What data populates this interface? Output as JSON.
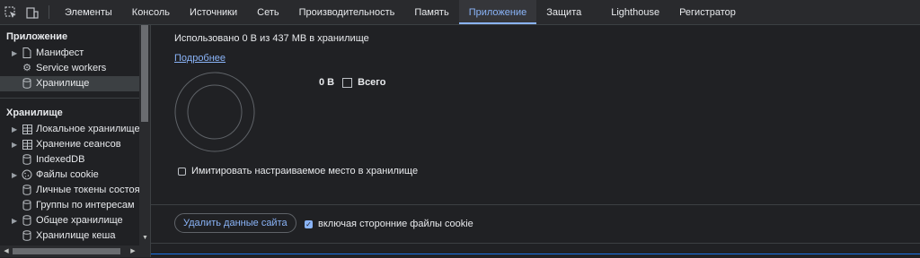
{
  "toolbar": {
    "icons": [
      "inspect-element-icon",
      "device-toolbar-icon"
    ],
    "tabs": [
      {
        "label": "Элементы"
      },
      {
        "label": "Консоль"
      },
      {
        "label": "Источники"
      },
      {
        "label": "Сеть"
      },
      {
        "label": "Производительность"
      },
      {
        "label": "Память"
      },
      {
        "label": "Приложение"
      },
      {
        "label": "Защита"
      },
      {
        "label": "Lighthouse"
      },
      {
        "label": "Регистратор"
      }
    ],
    "active_tab": "Приложение"
  },
  "sidebar": {
    "app_section": {
      "title": "Приложение",
      "items": [
        {
          "label": "Манифест",
          "icon": "file-icon"
        },
        {
          "label": "Service workers",
          "icon": "gears-icon"
        },
        {
          "label": "Хранилище",
          "icon": "database-icon"
        }
      ]
    },
    "storage_section": {
      "title": "Хранилище",
      "items": [
        {
          "label": "Локальное хранилище",
          "icon": "table-icon"
        },
        {
          "label": "Хранение сеансов",
          "icon": "table-icon"
        },
        {
          "label": "IndexedDB",
          "icon": "database-icon"
        },
        {
          "label": "Файлы cookie",
          "icon": "cookie-icon"
        },
        {
          "label": "Личные токены состояния",
          "icon": "database-icon"
        },
        {
          "label": "Группы по интересам",
          "icon": "database-icon"
        },
        {
          "label": "Общее хранилище",
          "icon": "database-icon"
        },
        {
          "label": "Хранилище кеша",
          "icon": "database-icon"
        }
      ]
    }
  },
  "main": {
    "usage_text": "Использовано 0 В из 437 MB в хранилище",
    "more_link": "Подробнее",
    "total_value": "0 В",
    "total_label": "Всего",
    "simulate_quota_label": "Имитировать настраиваемое место в хранилище",
    "simulate_quota_checked": false,
    "clear_button": "Удалить данные сайта",
    "third_party_cookies_label": "включая сторонние файлы cookie",
    "third_party_cookies_checked": true
  },
  "colors": {
    "accent": "#8ab4f8",
    "background": "#202124",
    "toolbar": "#292a2d"
  }
}
